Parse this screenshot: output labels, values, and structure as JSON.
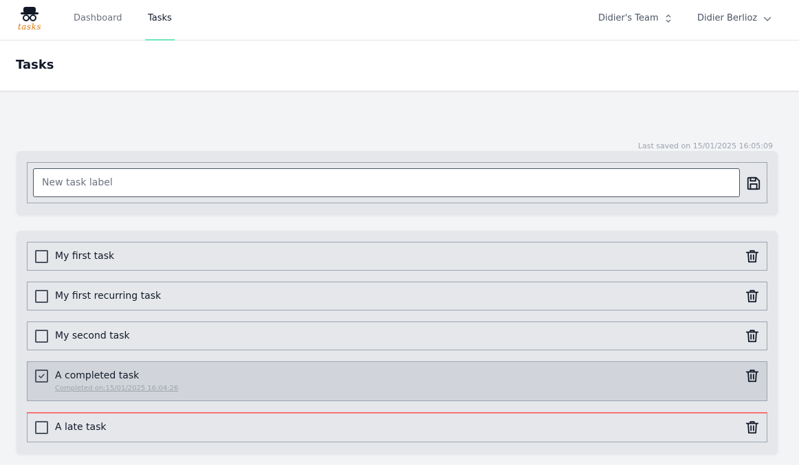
{
  "app": {
    "logo_text": "tasks"
  },
  "nav": {
    "links": [
      {
        "label": "Dashboard",
        "active": false
      },
      {
        "label": "Tasks",
        "active": true
      }
    ],
    "team": {
      "label": "Didier's Team"
    },
    "user": {
      "label": "Didier Berlioz"
    },
    "active_color": "#6ee7b7"
  },
  "page": {
    "title": "Tasks"
  },
  "status": {
    "last_saved": "Last saved on 15/01/2025 16:05:09"
  },
  "new_task": {
    "placeholder": "New task label",
    "value": ""
  },
  "tasks": [
    {
      "label": "My first task",
      "done": false,
      "late": false,
      "completed_text": ""
    },
    {
      "label": "My first recurring task",
      "done": false,
      "late": false,
      "completed_text": ""
    },
    {
      "label": "My second task",
      "done": false,
      "late": false,
      "completed_text": ""
    },
    {
      "label": "A completed task",
      "done": true,
      "late": false,
      "completed_text": "Completed on:15/01/2025 16:04:26"
    },
    {
      "label": "A late task",
      "done": false,
      "late": true,
      "completed_text": ""
    }
  ],
  "icons": {
    "logo": "spy-hat-glasses-icon",
    "save": "floppy-disk-icon",
    "delete": "trash-icon",
    "team_selector": "chevron-up-down-icon",
    "user_menu": "chevron-down-icon",
    "check": "check-icon"
  },
  "colors": {
    "late_accent": "#f87171",
    "logo_accent": "#d97706"
  }
}
